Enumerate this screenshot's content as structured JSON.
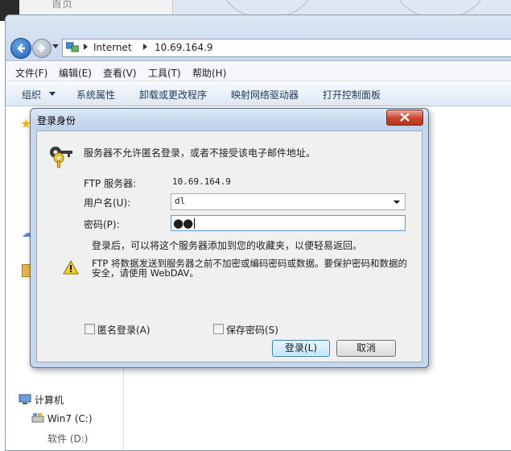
{
  "background": {
    "home_label": "首页"
  },
  "explorer": {
    "address": {
      "segment_1": "Internet",
      "segment_2": "10.69.164.9"
    },
    "menu": [
      "文件(F)",
      "编辑(E)",
      "查看(V)",
      "工具(T)",
      "帮助(H)"
    ],
    "commands": [
      "组织",
      "系统属性",
      "卸载或更改程序",
      "映射网络驱动器",
      "打开控制面板"
    ],
    "nav_tree": {
      "computer": "计算机",
      "win7_drive": "Win7 (C:)",
      "other_drive": "软件 (D:)"
    }
  },
  "dialog": {
    "title": "登录身份",
    "message": "服务器不允许匿名登录，或者不接受该电子邮件地址。",
    "ftp_server_label": "FTP 服务器:",
    "ftp_server_value": "10.69.164.9",
    "username_label": "用户名(U):",
    "username_value": "dl",
    "password_label": "密码(P):",
    "password_masked": "●●",
    "info_text": "登录后，可以将这个服务器添加到您的收藏夹，以便轻易返回。",
    "warning_text": "FTP 将数据发送到服务器之前不加密或编码密码或数据。要保护密码和数据的安全，请使用 WebDAV。",
    "anonymous_label": "匿名登录(A)",
    "anonymous_checked": false,
    "save_password_label": "保存密码(S)",
    "save_password_checked": false,
    "login_button": "登录(L)",
    "cancel_button": "取消"
  },
  "colors": {
    "dialog_frame": "#c6d8ee",
    "close_button": "#c8452f",
    "dialog_body": "#f0f0f0",
    "command_text": "#1e395b"
  }
}
